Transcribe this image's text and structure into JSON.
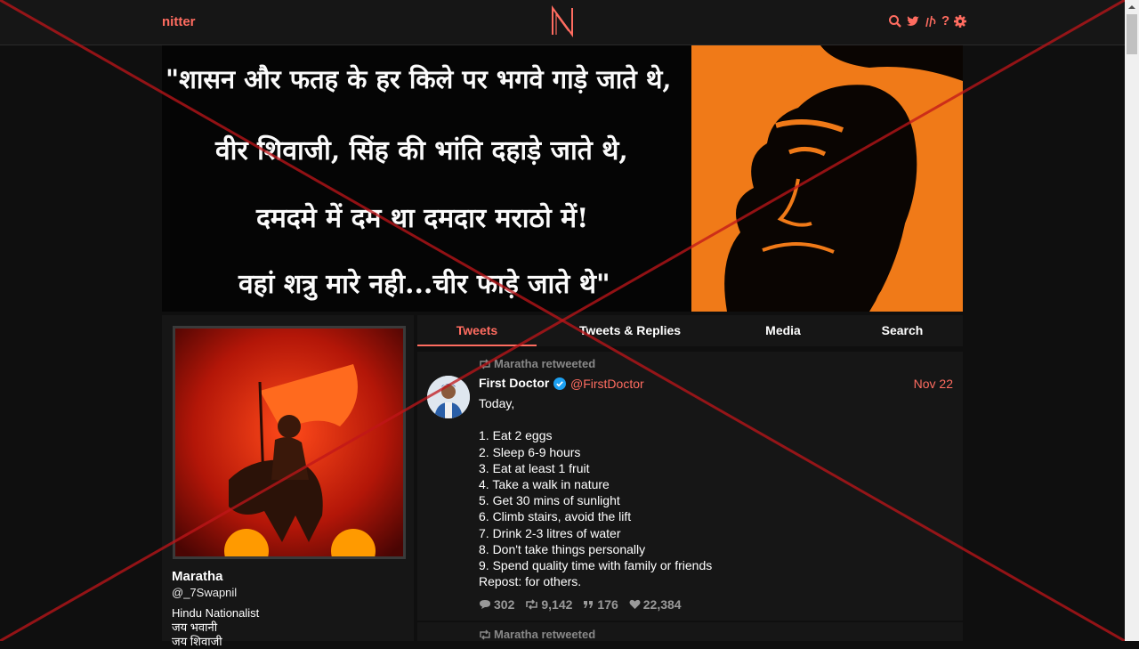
{
  "nav": {
    "brand": "nitter",
    "logo_letter": "N",
    "icons": [
      "search-icon",
      "twitter-icon",
      "rss-icon",
      "help-icon",
      "settings-icon"
    ],
    "help_glyph": "?"
  },
  "banner": {
    "lines": [
      "\"शासन और फतह के हर किले पर भगवे गाड़े जाते थे,",
      "वीर शिवाजी, सिंह की भांति दहाड़े जाते थे,",
      "दमदमे में दम था दमदार मराठो में!",
      "वहां शत्रु मारे नही...चीर फाड़े जाते थे\""
    ]
  },
  "profile": {
    "fullname": "Maratha",
    "username": "@_7Swapnil",
    "bio": [
      "Hindu Nationalist",
      "जय भवानी",
      "जय शिवाजी"
    ]
  },
  "tabs": [
    "Tweets",
    "Tweets & Replies",
    "Media",
    "Search"
  ],
  "tweets": [
    {
      "retweet_label": "Maratha retweeted",
      "fullname": "First Doctor",
      "username": "@FirstDoctor",
      "date": "Nov 22",
      "body": [
        "Today,",
        "",
        "1. Eat 2 eggs",
        "2. Sleep 6-9 hours",
        "3. Eat at least 1 fruit",
        "4. Take a walk in nature",
        "5. Get 30 mins of sunlight",
        "6. Climb stairs, avoid the lift",
        "7. Drink 2-3 litres of water",
        "8. Don't take things personally",
        "9. Spend quality time with family or friends",
        "Repost: for others."
      ],
      "stats": {
        "replies": "302",
        "retweets": "9,142",
        "quotes": "176",
        "likes": "22,384"
      }
    },
    {
      "retweet_label": "Maratha retweeted"
    }
  ],
  "colors": {
    "accent": "#ff6c60",
    "background": "#0f0f0f",
    "panel": "#161616",
    "banner_orange": "#f07a18",
    "overlay_line": "#c0151a"
  }
}
